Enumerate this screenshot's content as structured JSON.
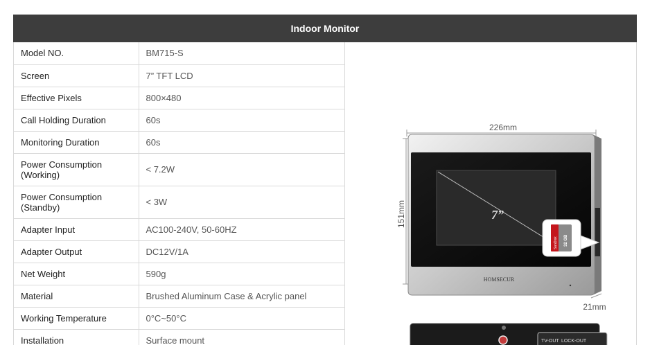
{
  "header": {
    "title": "Indoor Monitor"
  },
  "specs": [
    {
      "label": "Model NO.",
      "value": "BM715-S"
    },
    {
      "label": "Screen",
      "value": "7” TFT LCD"
    },
    {
      "label": "Effective Pixels",
      "value": "800×480"
    },
    {
      "label": "Call Holding Duration",
      "value": "60s"
    },
    {
      "label": "Monitoring Duration",
      "value": "60s"
    },
    {
      "label": "Power Consumption (Working)",
      "value": "< 7.2W"
    },
    {
      "label": "Power Consumption (Standby)",
      "value": "< 3W"
    },
    {
      "label": "Adapter Input",
      "value": "AC100-240V, 50-60HZ"
    },
    {
      "label": "Adapter Output",
      "value": "DC12V/1A"
    },
    {
      "label": "Net Weight",
      "value": "590g"
    },
    {
      "label": "Material",
      "value": "Brushed Aluminum Case & Acrylic panel"
    },
    {
      "label": "Working Temperature",
      "value": "0°C~50°C"
    },
    {
      "label": "Installation",
      "value": "Surface mount"
    }
  ],
  "product_image": {
    "width_dimension": "226mm",
    "height_dimension": "151mm",
    "depth_dimension": "21mm",
    "screen_size_label": "7”",
    "brand_label": "HOMSECUR",
    "sd_card_brand": "SanDisk",
    "sd_card_capacity": "32 GB",
    "back_panel_labels": [
      "TV-OUT",
      "LOCK-OUT"
    ]
  }
}
